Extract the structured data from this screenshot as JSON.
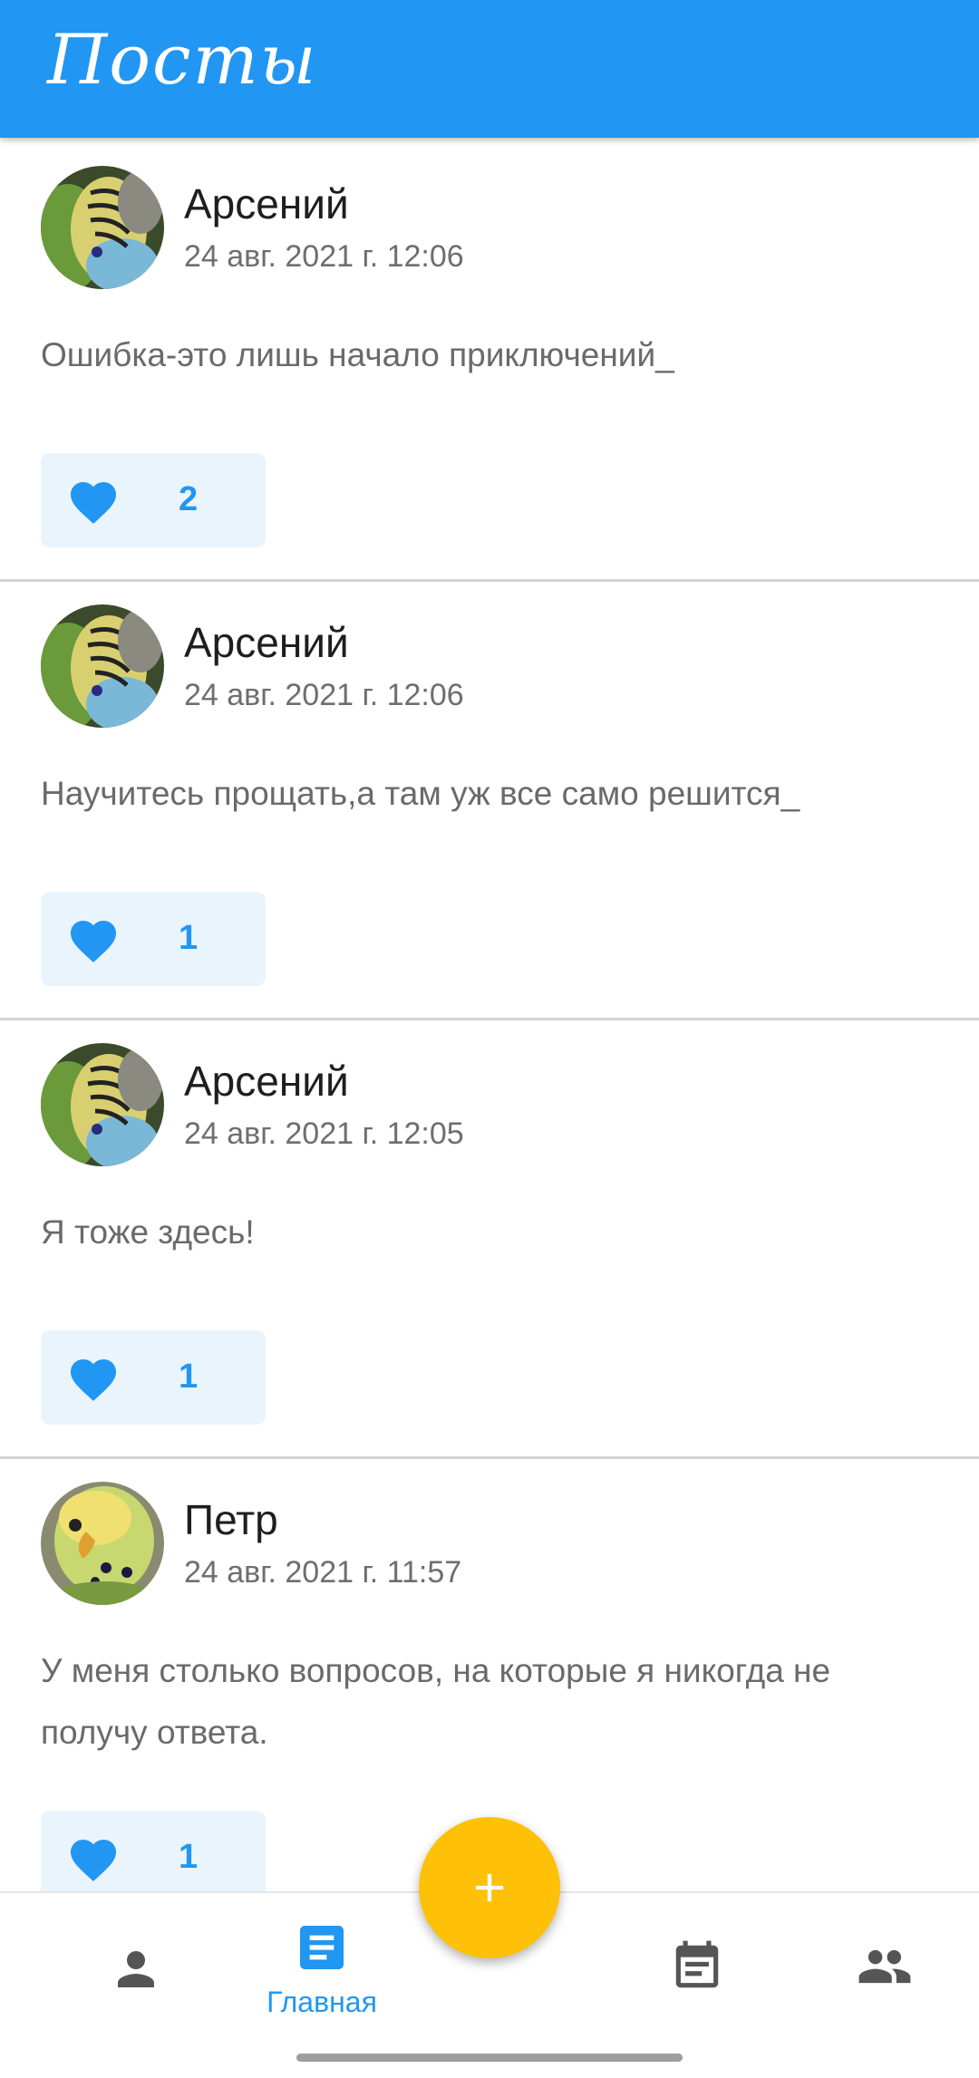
{
  "app": {
    "title": "Посты"
  },
  "posts": [
    {
      "author": "Арсений",
      "date": "24 авг. 2021 г. 12:06",
      "text": "Ошибка-это лишь начало приключений_",
      "likes": "2",
      "avatar_colors": [
        "#5a8c3a",
        "#e8d860",
        "#7ab8d8"
      ]
    },
    {
      "author": "Арсений",
      "date": "24 авг. 2021 г. 12:06",
      "text": "Научитесь прощать,а там уж все само решится_",
      "likes": "1",
      "avatar_colors": [
        "#5a8c3a",
        "#e8d860",
        "#7ab8d8"
      ]
    },
    {
      "author": "Арсений",
      "date": "24 авг. 2021 г. 12:05",
      "text": "Я тоже здесь!",
      "likes": "1",
      "avatar_colors": [
        "#5a8c3a",
        "#e8d860",
        "#7ab8d8"
      ]
    },
    {
      "author": "Петр",
      "date": "24 авг. 2021 г. 11:57",
      "text": "У меня столько вопросов, на которые я никогда не получу ответа.",
      "likes": "1",
      "avatar_colors": [
        "#a8c858",
        "#f0e070",
        "#7a9a40"
      ]
    }
  ],
  "nav": {
    "items": [
      {
        "icon": "person-icon",
        "label": "",
        "active": false
      },
      {
        "icon": "article-icon",
        "label": "Главная",
        "active": true
      },
      {
        "icon": "calendar-icon",
        "label": "",
        "active": false
      },
      {
        "icon": "group-icon",
        "label": "",
        "active": false
      }
    ],
    "fab_icon": "plus-icon"
  },
  "colors": {
    "primary": "#2196f3",
    "accent": "#ffc107",
    "nav_icon": "#555555",
    "like_bg": "#eaf4fd"
  }
}
